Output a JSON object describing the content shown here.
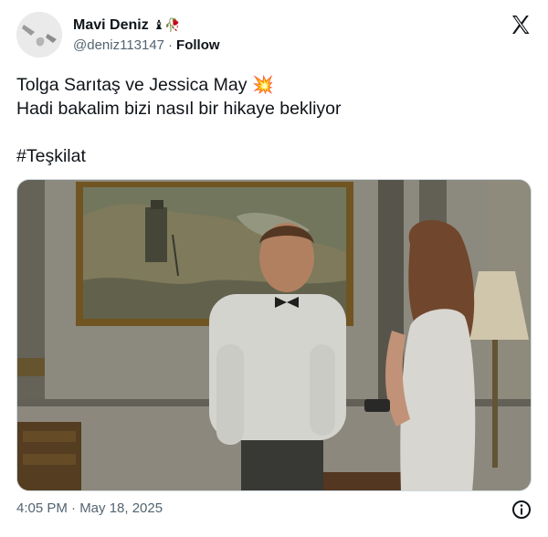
{
  "author": {
    "display_name": "Mavi Deniz",
    "name_emojis": "♝🥀",
    "handle": "@deniz113147",
    "separator": "·",
    "follow_label": "Follow"
  },
  "tweet": {
    "line1": "Tolga Sarıtaş ve Jessica May",
    "line1_emoji": "💥",
    "line2": "Hadi bakalim bizi nasıl bir hikaye bekliyor",
    "hashtag": "#Teşkilat"
  },
  "footer": {
    "timestamp": "4:05 PM · May 18, 2025"
  },
  "icons": {
    "brand": "x-logo-icon",
    "info": "info-icon"
  },
  "colors": {
    "text": "#0f1419",
    "secondary": "#536471",
    "border": "#cfd9de"
  }
}
